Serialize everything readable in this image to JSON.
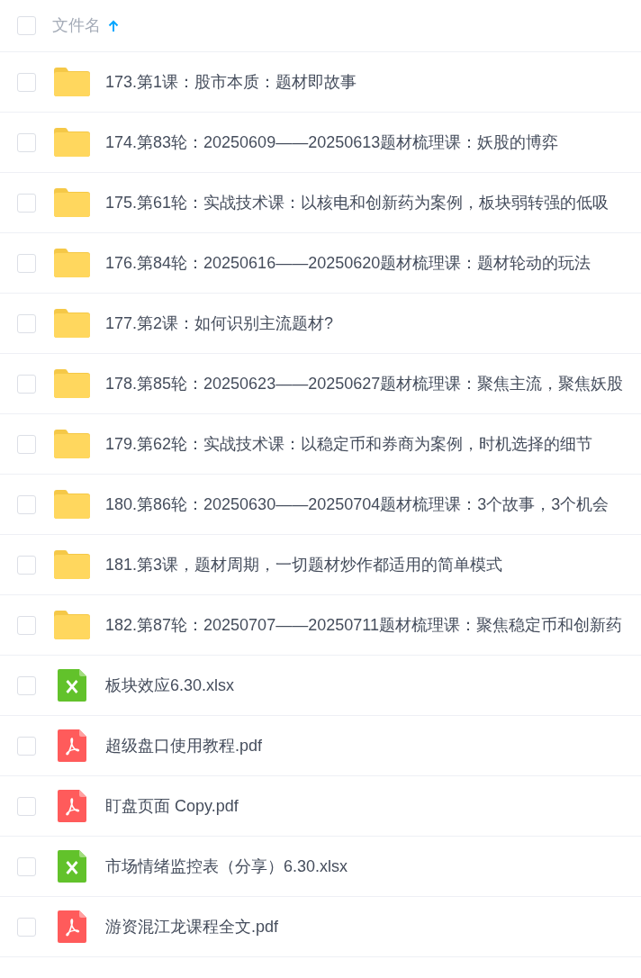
{
  "header": {
    "checked": false,
    "label": "文件名",
    "sorted_ascending": true
  },
  "files": [
    {
      "kind": "folder",
      "name": "173.第1课：股市本质：题材即故事",
      "checked": false
    },
    {
      "kind": "folder",
      "name": "174.第83轮：20250609——20250613题材梳理课：妖股的博弈",
      "checked": false
    },
    {
      "kind": "folder",
      "name": "175.第61轮：实战技术课：以核电和创新药为案例，板块弱转强的低吸",
      "checked": false
    },
    {
      "kind": "folder",
      "name": "176.第84轮：20250616——20250620题材梳理课：题材轮动的玩法",
      "checked": false
    },
    {
      "kind": "folder",
      "name": "177.第2课：如何识别主流题材?",
      "checked": false
    },
    {
      "kind": "folder",
      "name": "178.第85轮：20250623——20250627题材梳理课：聚焦主流，聚焦妖股",
      "checked": false
    },
    {
      "kind": "folder",
      "name": "179.第62轮：实战技术课：以稳定币和券商为案例，时机选择的细节",
      "checked": false
    },
    {
      "kind": "folder",
      "name": "180.第86轮：20250630——20250704题材梳理课：3个故事，3个机会",
      "checked": false
    },
    {
      "kind": "folder",
      "name": "181.第3课，题材周期，一切题材炒作都适用的简单模式",
      "checked": false
    },
    {
      "kind": "folder",
      "name": "182.第87轮：20250707——20250711题材梳理课：聚焦稳定币和创新药",
      "checked": false
    },
    {
      "kind": "xlsx",
      "name": "板块效应6.30.xlsx",
      "checked": false
    },
    {
      "kind": "pdf",
      "name": "超级盘口使用教程.pdf",
      "checked": false
    },
    {
      "kind": "pdf",
      "name": "盯盘页面 Copy.pdf",
      "checked": false
    },
    {
      "kind": "xlsx",
      "name": "市场情绪监控表（分享）6.30.xlsx",
      "checked": false
    },
    {
      "kind": "pdf",
      "name": "游资混江龙课程全文.pdf",
      "checked": false
    }
  ]
}
